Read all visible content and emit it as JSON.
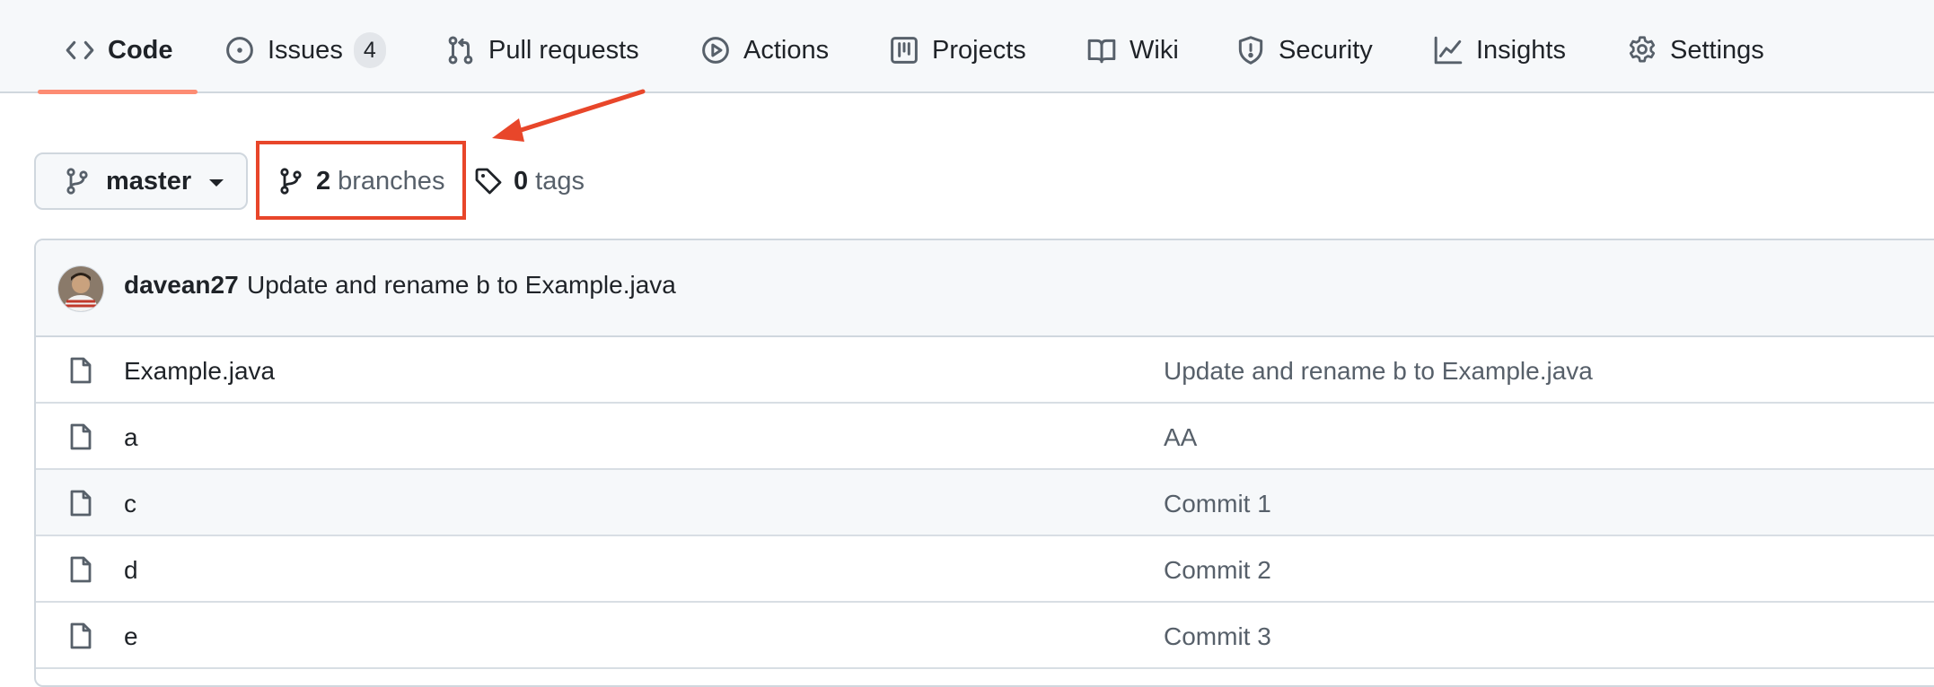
{
  "nav": {
    "tabs": [
      {
        "label": "Code",
        "icon": "code-icon"
      },
      {
        "label": "Issues",
        "icon": "issue-opened-icon",
        "count": "4"
      },
      {
        "label": "Pull requests",
        "icon": "git-pull-request-icon"
      },
      {
        "label": "Actions",
        "icon": "play-icon"
      },
      {
        "label": "Projects",
        "icon": "table-icon"
      },
      {
        "label": "Wiki",
        "icon": "book-icon"
      },
      {
        "label": "Security",
        "icon": "shield-icon"
      },
      {
        "label": "Insights",
        "icon": "graph-icon"
      },
      {
        "label": "Settings",
        "icon": "gear-icon"
      }
    ],
    "selected": "Code"
  },
  "branch": {
    "current": "master",
    "branches_count": "2",
    "branches_label": "branches",
    "tags_count": "0",
    "tags_label": "tags"
  },
  "latest_commit": {
    "author": "davean27",
    "message": "Update and rename b to Example.java"
  },
  "files": [
    {
      "name": "Example.java",
      "commit": "Update and rename b to Example.java"
    },
    {
      "name": "a",
      "commit": "AA"
    },
    {
      "name": "c",
      "commit": "Commit 1"
    },
    {
      "name": "d",
      "commit": "Commit 2"
    },
    {
      "name": "e",
      "commit": "Commit 3"
    }
  ],
  "colors": {
    "annotation": "#e8462a",
    "tab_underline": "#fd8c73",
    "border": "#d0d7de",
    "muted_text": "#57606a"
  }
}
